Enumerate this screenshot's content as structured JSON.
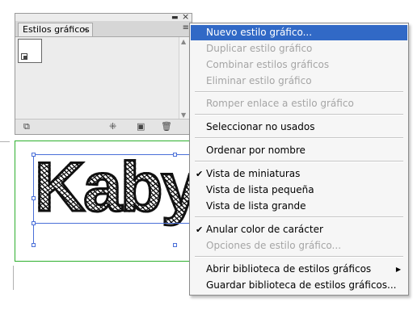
{
  "panel": {
    "tab_label": "Estilos gráficos",
    "tab_close": "×",
    "collapse_glyph": "▬",
    "close_glyph": "×",
    "menu_glyph": "≡"
  },
  "canvas": {
    "text": "Kaby",
    "frame_color": "#2eb02e",
    "selection_color": "#4a6fd8"
  },
  "menu": {
    "highlight_color": "#3169c6",
    "items": [
      {
        "label": "Nuevo estilo gráfico...",
        "state": "highlighted"
      },
      {
        "label": "Duplicar estilo gráfico",
        "state": "disabled"
      },
      {
        "label": "Combinar estilos gráficos",
        "state": "disabled"
      },
      {
        "label": "Eliminar estilo gráfico",
        "state": "disabled"
      },
      {
        "label": "Romper enlace a estilo gráfico",
        "state": "disabled"
      },
      {
        "label": "Seleccionar no usados",
        "state": "enabled"
      },
      {
        "label": "Ordenar por nombre",
        "state": "enabled"
      },
      {
        "label": "Vista de miniaturas",
        "state": "checked"
      },
      {
        "label": "Vista de lista pequeña",
        "state": "enabled"
      },
      {
        "label": "Vista de lista grande",
        "state": "enabled"
      },
      {
        "label": "Anular color de carácter",
        "state": "checked"
      },
      {
        "label": "Opciones de estilo gráfico...",
        "state": "disabled"
      },
      {
        "label": "Abrir biblioteca de estilos gráficos",
        "state": "submenu"
      },
      {
        "label": "Guardar biblioteca de estilos gráficos...",
        "state": "enabled"
      }
    ]
  }
}
